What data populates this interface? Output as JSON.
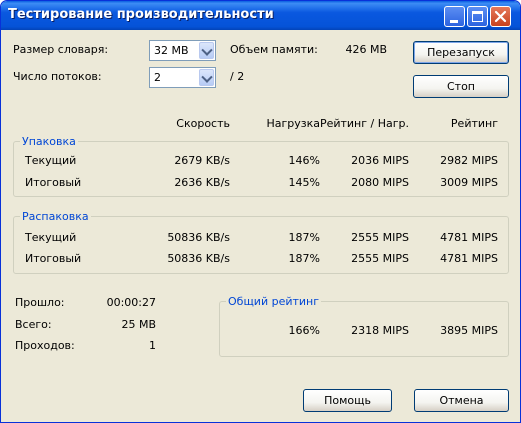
{
  "window": {
    "title": "Тестирование производительности"
  },
  "settings": {
    "dict_label": "Размер словаря:",
    "dict_value": "32 MB",
    "threads_label": "Число потоков:",
    "threads_value": "2",
    "threads_max": "/ 2",
    "memory_label": "Объем памяти:",
    "memory_value": "426 MB"
  },
  "buttons": {
    "restart": "Перезапуск",
    "stop": "Стоп",
    "help": "Помощь",
    "cancel": "Отмена"
  },
  "columns": {
    "speed": "Скорость",
    "load": "Нагрузка",
    "rating_per_load": "Рейтинг / Нагр.",
    "rating": "Рейтинг"
  },
  "compression": {
    "title": "Упаковка",
    "rows": [
      {
        "label": "Текущий",
        "speed": "2679 KB/s",
        "load": "146%",
        "rpl": "2036 MIPS",
        "rating": "2982 MIPS"
      },
      {
        "label": "Итоговый",
        "speed": "2636 KB/s",
        "load": "145%",
        "rpl": "2080 MIPS",
        "rating": "3009 MIPS"
      }
    ]
  },
  "decompression": {
    "title": "Распаковка",
    "rows": [
      {
        "label": "Текущий",
        "speed": "50836 KB/s",
        "load": "187%",
        "rpl": "2555 MIPS",
        "rating": "4781 MIPS"
      },
      {
        "label": "Итоговый",
        "speed": "50836 KB/s",
        "load": "187%",
        "rpl": "2555 MIPS",
        "rating": "4781 MIPS"
      }
    ]
  },
  "stats": {
    "elapsed_label": "Прошло:",
    "elapsed_value": "00:00:27",
    "size_label": "Всего:",
    "size_value": "25 MB",
    "passes_label": "Проходов:",
    "passes_value": "1"
  },
  "total": {
    "title": "Общий рейтинг",
    "load": "166%",
    "rpl": "2318 MIPS",
    "rating": "3895 MIPS"
  }
}
